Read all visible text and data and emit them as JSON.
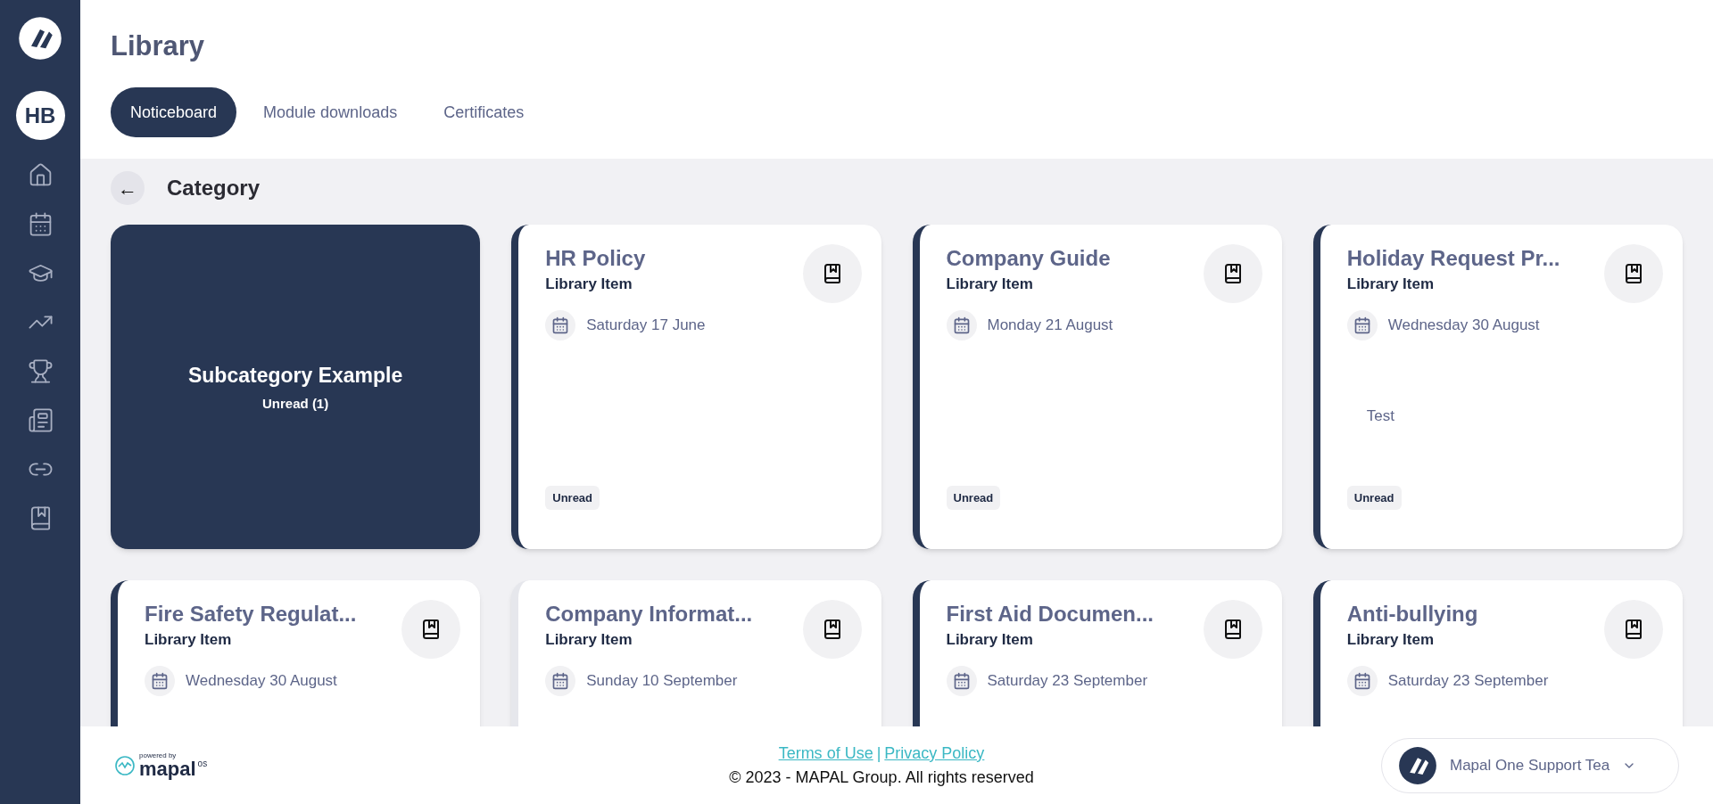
{
  "sidebar": {
    "avatar": "HB",
    "items": [
      {
        "kind": "home",
        "selected": false
      },
      {
        "kind": "calendar",
        "selected": false
      },
      {
        "kind": "learning",
        "selected": false
      },
      {
        "kind": "trend",
        "selected": false
      },
      {
        "kind": "trophy",
        "selected": false
      },
      {
        "kind": "news",
        "selected": false
      },
      {
        "kind": "link",
        "selected": false
      },
      {
        "kind": "library",
        "selected": false
      }
    ]
  },
  "page_title": "Library",
  "tabs": [
    {
      "label": "Noticeboard",
      "selected": true
    },
    {
      "label": "Module downloads",
      "selected": false
    },
    {
      "label": "Certificates",
      "selected": false
    }
  ],
  "category": {
    "back": "←",
    "title": "Category"
  },
  "cards": [
    {
      "kind": "subcategory",
      "title": "Subcategory Example",
      "subtitle": "Unread (1)"
    },
    {
      "kind": "item",
      "title": "HR Policy",
      "subtitle": "Library Item",
      "date": "Saturday 17 June",
      "unread": true,
      "badge": "Unread"
    },
    {
      "kind": "item",
      "title": "Company Guide",
      "subtitle": "Library Item",
      "date": "Monday 21 August",
      "unread": true,
      "badge": "Unread"
    },
    {
      "kind": "item",
      "title": "Holiday Request Pr...",
      "subtitle": "Library Item",
      "date": "Wednesday 30 August",
      "body": "Test",
      "unread": true,
      "badge": "Unread"
    },
    {
      "kind": "item",
      "title": "Fire Safety Regulat...",
      "subtitle": "Library Item",
      "date": "Wednesday 30 August",
      "unread": true
    },
    {
      "kind": "item",
      "title": "Company Informat...",
      "subtitle": "Library Item",
      "date": "Sunday 10 September",
      "unread": false
    },
    {
      "kind": "item",
      "title": "First Aid Documen...",
      "subtitle": "Library Item",
      "date": "Saturday 23 September",
      "unread": true
    },
    {
      "kind": "item",
      "title": "Anti-bullying",
      "subtitle": "Library Item",
      "date": "Saturday 23 September",
      "unread": true
    }
  ],
  "footer": {
    "powered_by": "powered by",
    "brand": "mapal",
    "brand_suffix": "os",
    "links": [
      "Terms of Use",
      "Privacy Policy"
    ],
    "separator": "|",
    "copyright": "© 2023 - MAPAL Group. All rights reserved",
    "support": "Mapal One Support Tea"
  }
}
